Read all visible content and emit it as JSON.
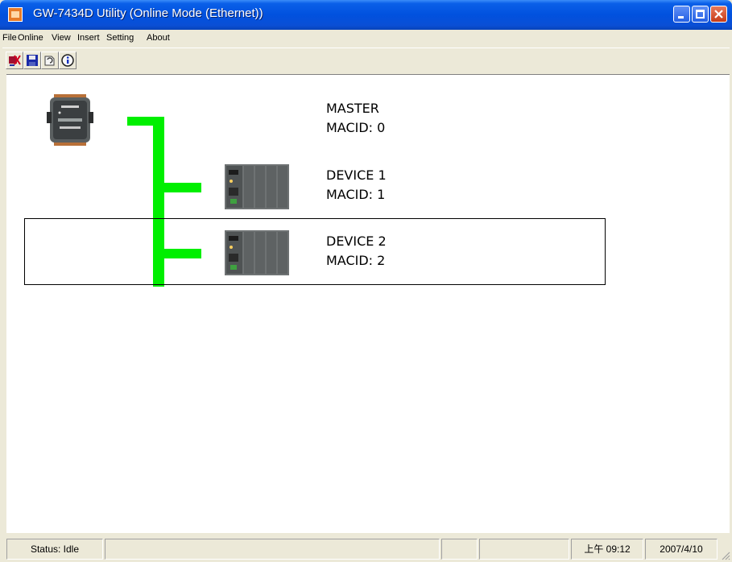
{
  "window": {
    "title": "GW-7434D Utility (Online Mode (Ethernet))"
  },
  "menu": [
    "File",
    "Online",
    "View",
    "Insert",
    "Setting",
    "About"
  ],
  "toolbar": {
    "icons": [
      "disconnect-icon",
      "save-icon",
      "load-config-icon",
      "about-icon"
    ]
  },
  "diagram": {
    "master": {
      "name": "MASTER",
      "macid": "MACID:  0"
    },
    "devices": [
      {
        "name": "DEVICE 1",
        "macid": "MACID:  1"
      },
      {
        "name": "DEVICE 2",
        "macid": "MACID:  2"
      }
    ],
    "bus_color": "#00ef00"
  },
  "status": {
    "text": "Status: Idle",
    "time": "上午 09:12",
    "date": "2007/4/10"
  }
}
